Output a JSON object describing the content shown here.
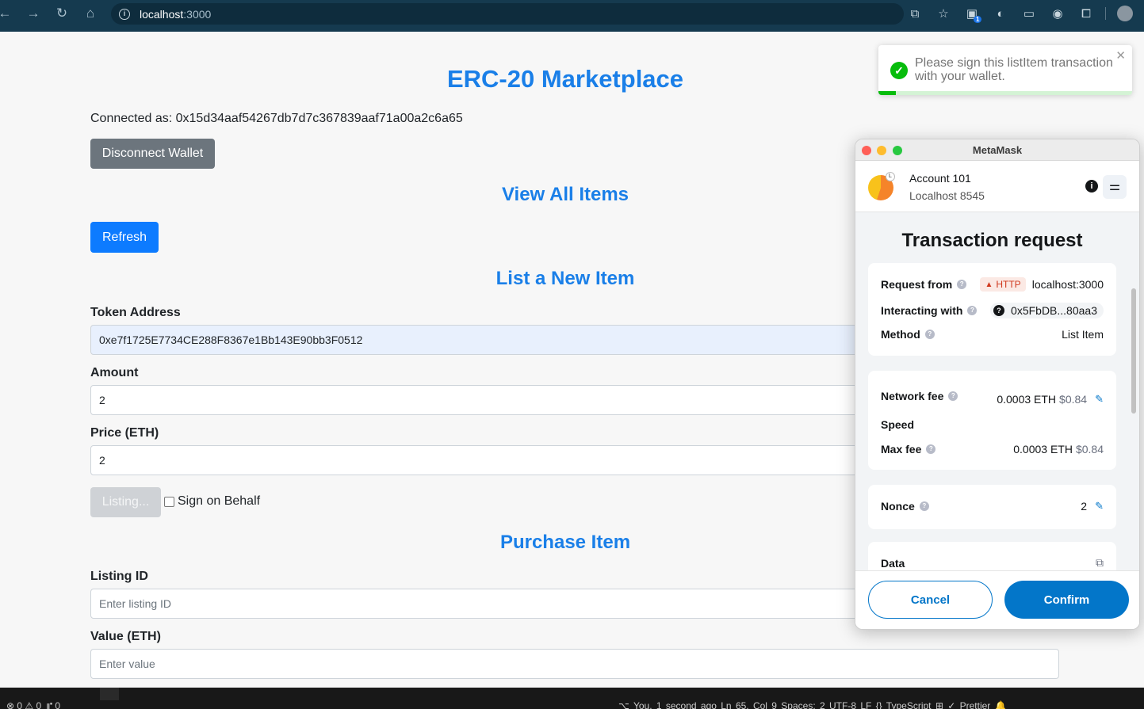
{
  "browser": {
    "url_host": "localhost",
    "url_port": ":3000",
    "extension_badge": "1"
  },
  "page": {
    "title": "ERC-20 Marketplace",
    "connected_prefix": "Connected as: ",
    "connected_address": "0x15d34aaf54267db7d7c367839aaf71a00a2c6a65",
    "disconnect_label": "Disconnect Wallet",
    "view_all_heading": "View All Items",
    "refresh_label": "Refresh",
    "list_heading": "List a New Item",
    "token_address_label": "Token Address",
    "token_address_value": "0xe7f1725E7734CE288F8367e1Bb143E90bb3F0512",
    "amount_label": "Amount",
    "amount_value": "2",
    "price_label": "Price (ETH)",
    "price_value": "2",
    "listing_button": "Listing...",
    "sign_on_behalf_label": "Sign on Behalf",
    "purchase_heading": "Purchase Item",
    "listing_id_label": "Listing ID",
    "listing_id_placeholder": "Enter listing ID",
    "value_label": "Value (ETH)",
    "value_placeholder": "Enter value"
  },
  "toast": {
    "message": "Please sign this listItem transaction with your wallet.",
    "progress_fraction": 0.07,
    "accent_color": "#07bc0c"
  },
  "metamask": {
    "window_title": "MetaMask",
    "account_badge": "L",
    "account_name": "Account 101",
    "network": "Localhost 8545",
    "heading": "Transaction request",
    "request_from_label": "Request from",
    "http_tag": "HTTP",
    "request_from_value": "localhost:3000",
    "interacting_with_label": "Interacting with",
    "interacting_with_value": "0x5FbDB...80aa3",
    "method_label": "Method",
    "method_value": "List Item",
    "network_fee_label": "Network fee",
    "network_fee_eth": "0.0003 ETH",
    "network_fee_usd": "$0.84",
    "speed_label": "Speed",
    "max_fee_label": "Max fee",
    "max_fee_eth": "0.0003 ETH",
    "max_fee_usd": "$0.84",
    "nonce_label": "Nonce",
    "nonce_value": "2",
    "data_label": "Data",
    "cancel_label": "Cancel",
    "confirm_label": "Confirm",
    "accent_color": "#0376c9"
  },
  "statusbar": {
    "problems": "⊗ 0 ⚠ 0",
    "ports": "⑈ 0",
    "right_items": "⌥ You, 1 second ago   Ln 65, Col 9   Spaces: 2   UTF-8   LF   {} TypeScript   ⊞   ✓ Prettier   🔔"
  }
}
